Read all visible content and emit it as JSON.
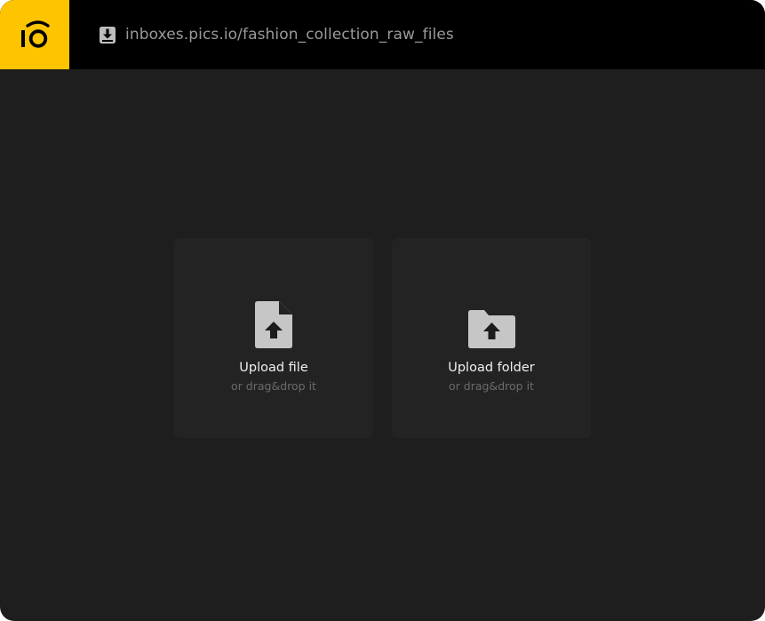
{
  "header": {
    "logo_icon": "pics-io-logo-icon",
    "url_icon": "download-inbox-icon",
    "url": "inboxes.pics.io/fashion_collection_raw_files"
  },
  "upload": {
    "file": {
      "icon": "file-upload-icon",
      "label": "Upload file",
      "hint": "or drag&drop it"
    },
    "folder": {
      "icon": "folder-upload-icon",
      "label": "Upload folder",
      "hint": "or drag&drop it"
    }
  },
  "colors": {
    "accent": "#ffc400",
    "topbar": "#000000",
    "background": "#1e1e1e",
    "card": "#232323"
  }
}
